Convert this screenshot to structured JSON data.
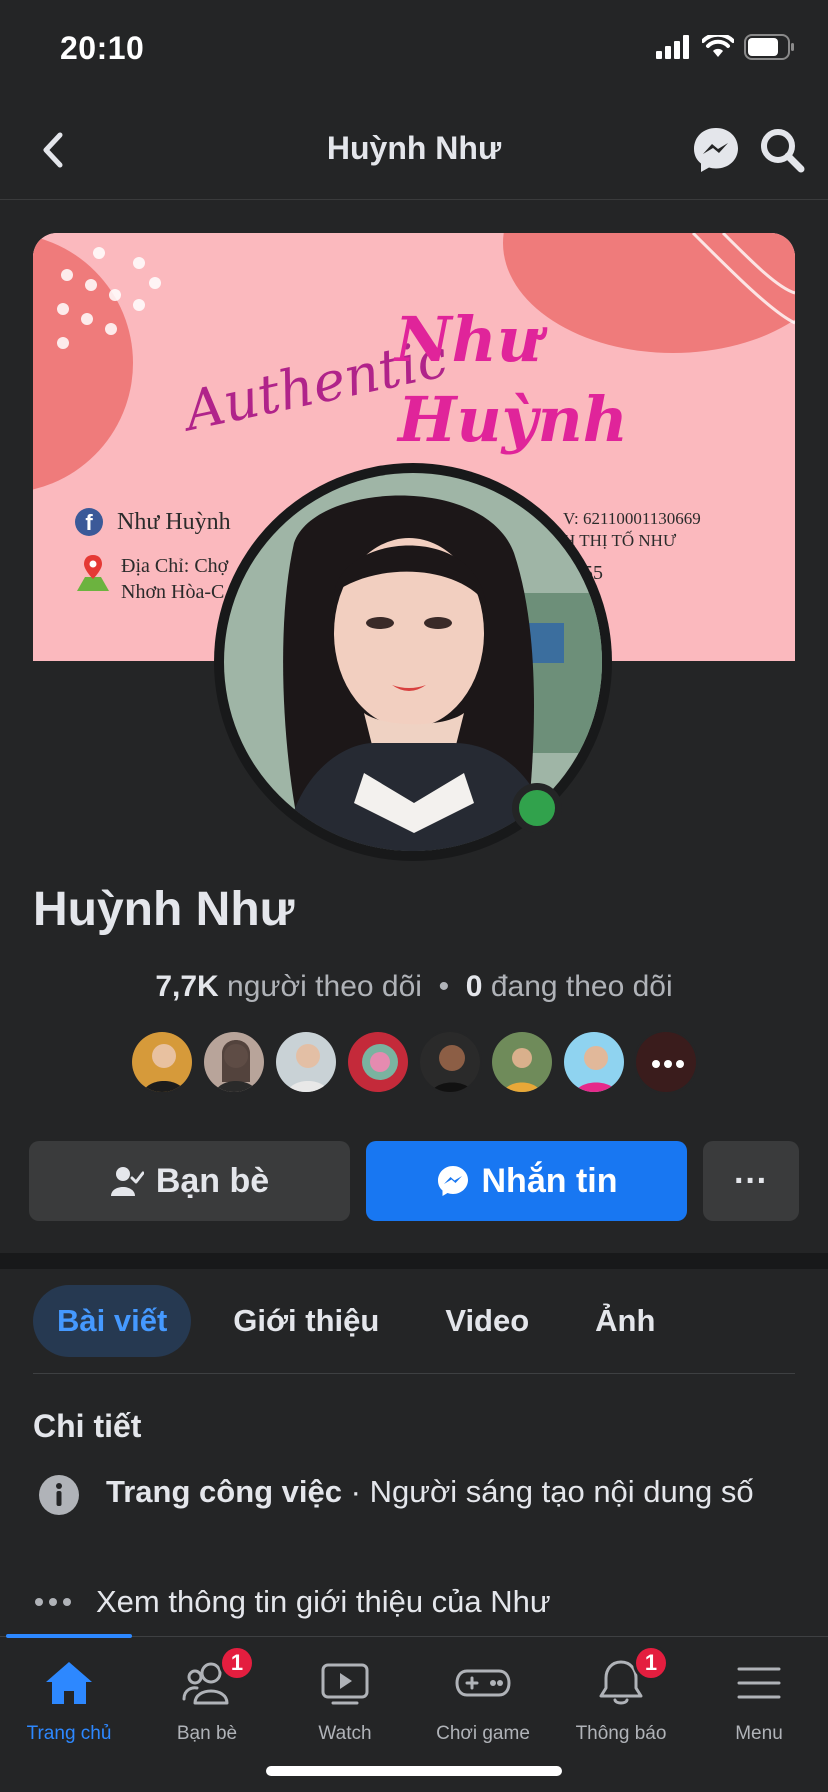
{
  "status_bar": {
    "time": "20:10"
  },
  "header": {
    "title": "Huỳnh Như"
  },
  "cover": {
    "authentic": "Authentic",
    "name_line1": "Như",
    "name_line2": "Huỳnh",
    "fb_name": "Như Huỳnh",
    "address_line1": "Địa Chỉ: Chợ",
    "address_line2": "Nhơn Hòa-C",
    "bank_line": "V: 62110001130669",
    "owner_line": "H THỊ TỐ NHƯ",
    "phone_partial": "3455"
  },
  "profile": {
    "name": "Huỳnh Như",
    "followers_count": "7,7K",
    "followers_label": "người theo dõi",
    "separator": "•",
    "following_count": "0",
    "following_label": "đang theo dõi"
  },
  "friends_preview": {
    "count_shown": 7,
    "more_icon": "more-dots-icon"
  },
  "actions": {
    "friends_label": "Bạn bè",
    "message_label": "Nhắn tin",
    "more_label": "···"
  },
  "tabs": [
    {
      "label": "Bài viết",
      "active": true
    },
    {
      "label": "Giới thiệu",
      "active": false
    },
    {
      "label": "Video",
      "active": false
    },
    {
      "label": "Ảnh",
      "active": false
    }
  ],
  "details": {
    "title": "Chi tiết",
    "work_label": "Trang công việc",
    "work_value": " · Người sáng tạo nội dung số",
    "about_link": "Xem thông tin giới thiệu của Như"
  },
  "bottom_nav": [
    {
      "label": "Trang chủ",
      "icon": "home-icon",
      "active": true,
      "badge": ""
    },
    {
      "label": "Bạn bè",
      "icon": "friends-icon",
      "active": false,
      "badge": "1"
    },
    {
      "label": "Watch",
      "icon": "watch-icon",
      "active": false,
      "badge": ""
    },
    {
      "label": "Chơi game",
      "icon": "gamepad-icon",
      "active": false,
      "badge": ""
    },
    {
      "label": "Thông báo",
      "icon": "bell-icon",
      "active": false,
      "badge": "1"
    },
    {
      "label": "Menu",
      "icon": "menu-icon",
      "active": false,
      "badge": ""
    }
  ],
  "colors": {
    "background": "#242526",
    "accent": "#1877f2",
    "active_tab_bg": "#263951",
    "badge": "#e41e3f",
    "online": "#31a24c"
  }
}
